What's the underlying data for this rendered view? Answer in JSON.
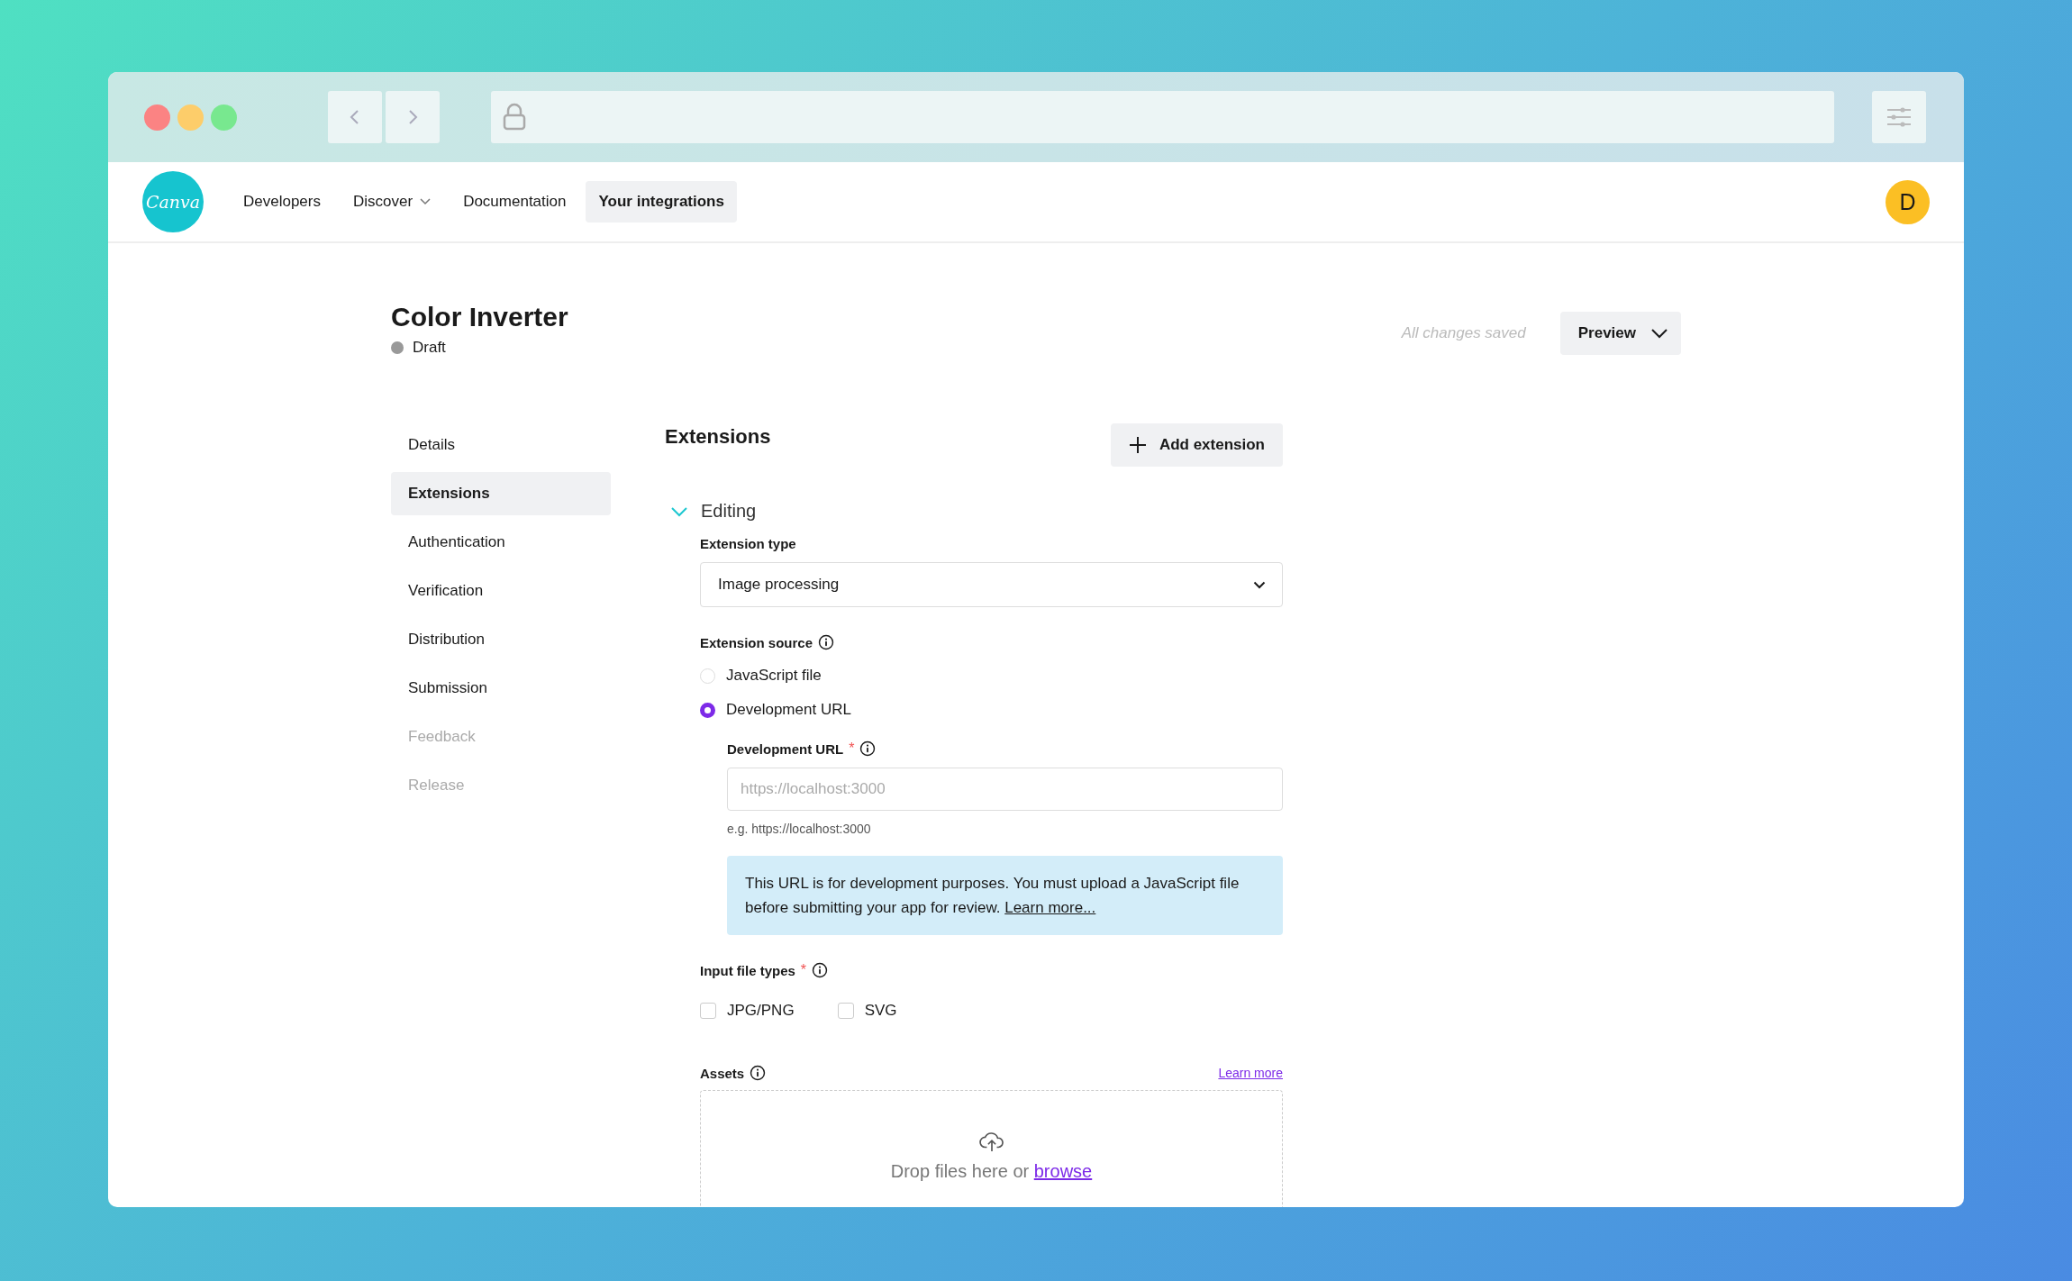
{
  "navbar": {
    "logo": "Canva",
    "items": [
      {
        "label": "Developers",
        "kind": "link",
        "selected": false
      },
      {
        "label": "Discover",
        "kind": "dropdown",
        "selected": false
      },
      {
        "label": "Documentation",
        "kind": "link",
        "selected": false
      },
      {
        "label": "Your integrations",
        "kind": "link",
        "selected": true
      }
    ],
    "avatar": "D"
  },
  "header": {
    "title": "Color Inverter",
    "status": "Draft",
    "save_status": "All changes saved",
    "preview_button": "Preview"
  },
  "sidebar": {
    "items": [
      {
        "label": "Details",
        "selected": false,
        "disabled": false
      },
      {
        "label": "Extensions",
        "selected": true,
        "disabled": false
      },
      {
        "label": "Authentication",
        "selected": false,
        "disabled": false
      },
      {
        "label": "Verification",
        "selected": false,
        "disabled": false
      },
      {
        "label": "Distribution",
        "selected": false,
        "disabled": false
      },
      {
        "label": "Submission",
        "selected": false,
        "disabled": false
      },
      {
        "label": "Feedback",
        "selected": false,
        "disabled": true
      },
      {
        "label": "Release",
        "selected": false,
        "disabled": true
      }
    ]
  },
  "section": {
    "title": "Extensions",
    "add_button": "Add extension"
  },
  "extension": {
    "title": "Editing",
    "expanded": true,
    "type_label": "Extension type",
    "type_value": "Image processing",
    "source_label": "Extension source",
    "source_options": [
      {
        "label": "JavaScript file",
        "selected": false
      },
      {
        "label": "Development URL",
        "selected": true
      }
    ],
    "dev_url": {
      "label": "Development URL",
      "required_mark": "*",
      "placeholder": "https://localhost:3000",
      "hint": "e.g. https://localhost:3000"
    },
    "notice": {
      "text": "This URL is for development purposes. You must upload a JavaScript file before submitting your app for review.",
      "link": "Learn more..."
    },
    "file_types": {
      "label": "Input file types",
      "required_mark": "*",
      "options": [
        {
          "label": "JPG/PNG",
          "checked": false
        },
        {
          "label": "SVG",
          "checked": false
        }
      ]
    },
    "assets": {
      "label": "Assets",
      "link": "Learn more",
      "drop_text": "Drop files here or",
      "browse": "browse"
    }
  }
}
